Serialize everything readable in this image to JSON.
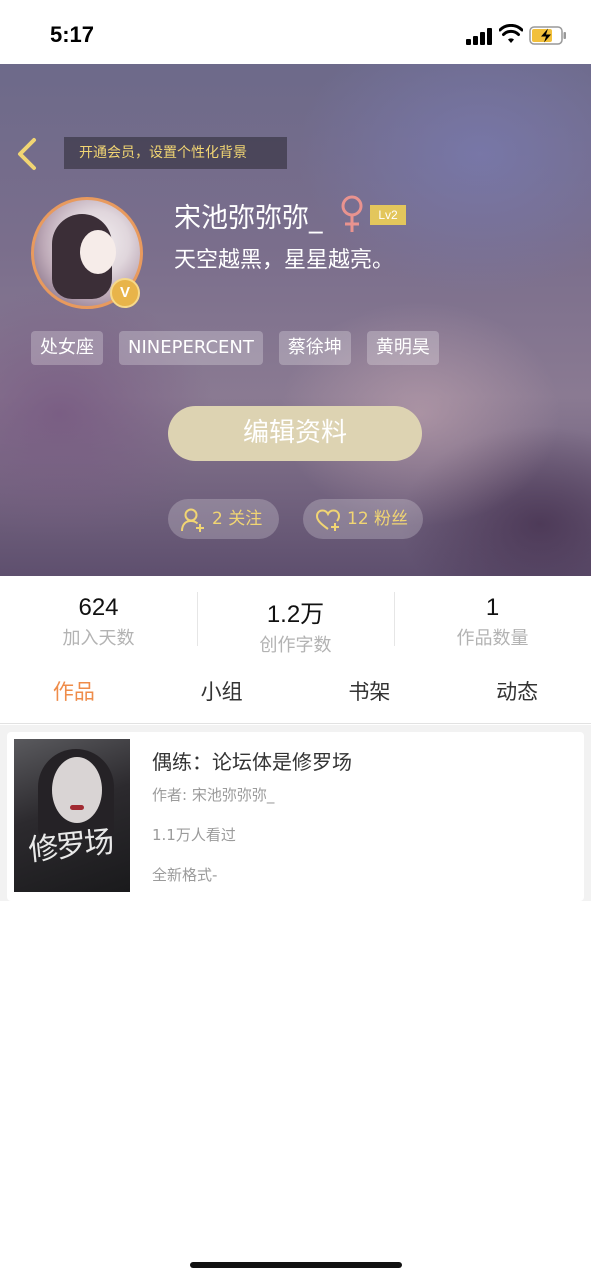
{
  "status_bar": {
    "time": "5:17"
  },
  "header": {
    "vip_banner": "开通会员，设置个性化背景",
    "username": "宋池弥弥弥_",
    "level": "Lv2",
    "signature": "天空越黑，星星越亮。",
    "avatar_badge": "V",
    "tags": [
      "处女座",
      "NINEPERCENT",
      "蔡徐坤",
      "黄明昊"
    ],
    "edit_button": "编辑资料",
    "following_label": "2 关注",
    "fans_label": "12 粉丝"
  },
  "stats": [
    {
      "value": "624",
      "label": "加入天数"
    },
    {
      "value": "1.2万",
      "label": "创作字数"
    },
    {
      "value": "1",
      "label": "作品数量"
    }
  ],
  "tabs": [
    "作品",
    "小组",
    "书架",
    "动态"
  ],
  "active_tab": "作品",
  "works": [
    {
      "title": "偶练：论坛体是修罗场",
      "author": "作者: 宋池弥弥弥_",
      "views": "1.1万人看过",
      "description": "全新格式-",
      "cover_text": "修罗场"
    }
  ],
  "colors": {
    "accent": "#ef8c4a",
    "gold": "#f1d573",
    "edit_button": "#ddd3b2"
  },
  "icons": {
    "back": "chevron-left-icon",
    "gender": "female-icon",
    "following": "user-add-icon",
    "fans": "heart-add-icon"
  }
}
